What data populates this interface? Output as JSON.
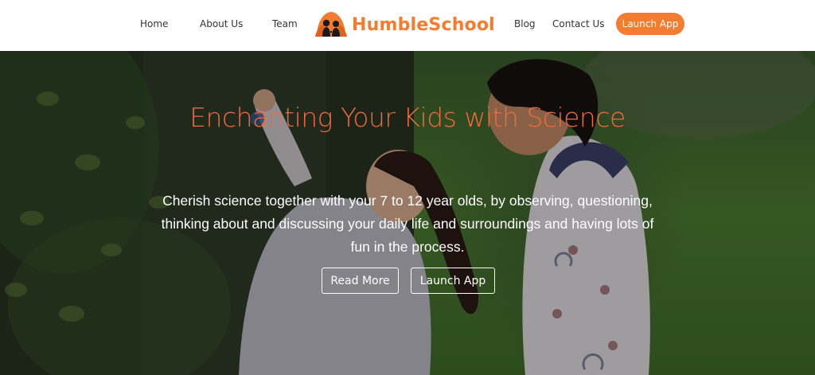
{
  "nav": {
    "home": "Home",
    "about": "About Us",
    "team": "Team",
    "brand": "HumbleSchool",
    "blog": "Blog",
    "contact": "Contact Us",
    "launch_app": "Launch App"
  },
  "hero": {
    "title": "Enchanting Your Kids with Science",
    "subtitle": "Cherish science together with your 7 to 12 year olds, by observing, questioning, thinking about and discussing your daily life and surroundings and having lots of fun in the process.",
    "read_more": "Read More",
    "launch_app": "Launch App"
  },
  "colors": {
    "brand": "#f47c30",
    "hero_title": "#ef6a3c",
    "hero_text": "#ffffff"
  },
  "icons": {
    "logo": "children-silhouette-logo-icon"
  }
}
